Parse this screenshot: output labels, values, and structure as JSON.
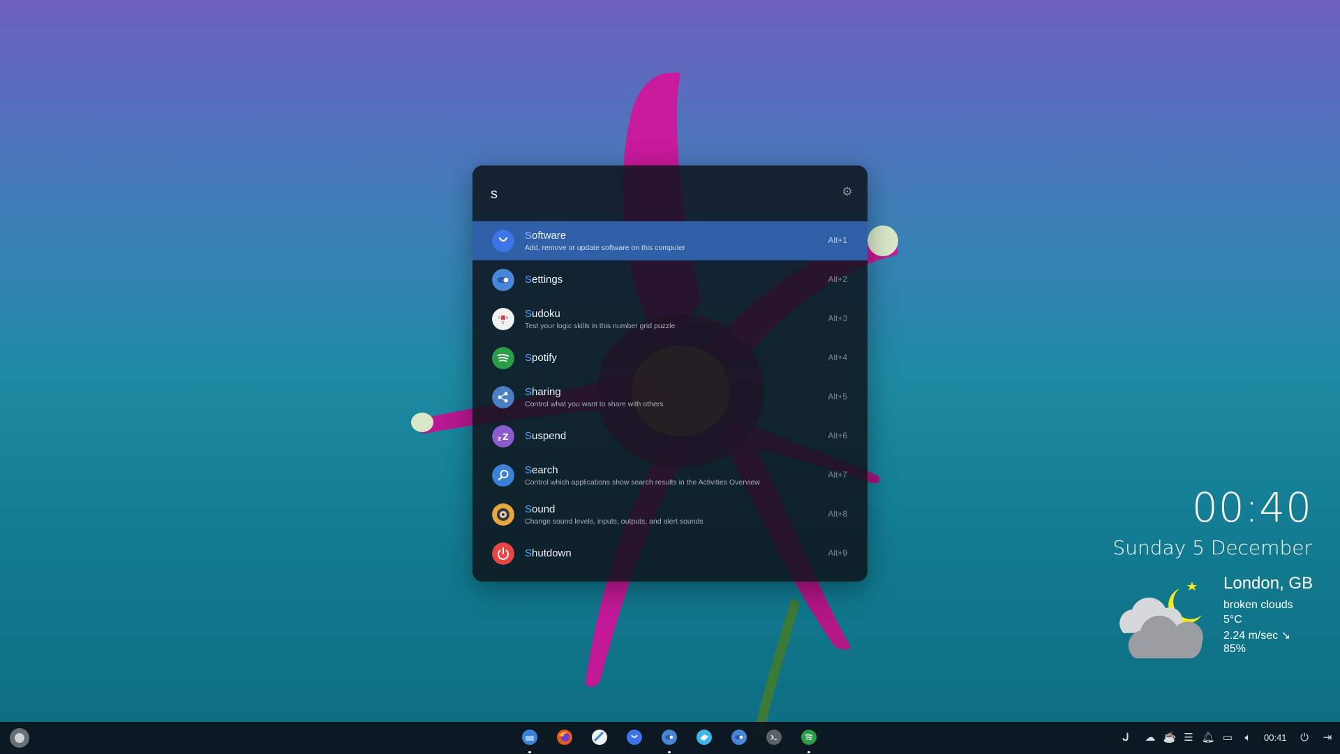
{
  "launcher": {
    "query": "s",
    "results": [
      {
        "hl": "S",
        "rest": "oftware",
        "desc": "Add, remove or update software on this computer",
        "shortcut": "Alt+1",
        "icon": "software-bag-icon"
      },
      {
        "hl": "S",
        "rest": "ettings",
        "desc": "",
        "shortcut": "Alt+2",
        "icon": "settings-toggle-icon"
      },
      {
        "hl": "S",
        "rest": "udoku",
        "desc": "Test your logic skills in this number grid puzzle",
        "shortcut": "Alt+3",
        "icon": "sudoku-icon"
      },
      {
        "hl": "S",
        "rest": "potify",
        "desc": "",
        "shortcut": "Alt+4",
        "icon": "spotify-icon"
      },
      {
        "hl": "S",
        "rest": "haring",
        "desc": "Control what you want to share with others",
        "shortcut": "Alt+5",
        "icon": "sharing-icon"
      },
      {
        "hl": "S",
        "rest": "uspend",
        "desc": "",
        "shortcut": "Alt+6",
        "icon": "suspend-icon"
      },
      {
        "hl": "S",
        "rest": "earch",
        "desc": "Control which applications show search results in the Activities Overview",
        "shortcut": "Alt+7",
        "icon": "search-icon"
      },
      {
        "hl": "S",
        "rest": "ound",
        "desc": "Change sound levels, inputs, outputs, and alert sounds",
        "shortcut": "Alt+8",
        "icon": "sound-icon"
      },
      {
        "hl": "S",
        "rest": "hutdown",
        "desc": "",
        "shortcut": "Alt+9",
        "icon": "shutdown-icon"
      }
    ]
  },
  "clock": {
    "time": "00:40",
    "date": "Sunday  5 December"
  },
  "weather": {
    "city": "London, GB",
    "condition": "broken clouds",
    "temperature": "5°C",
    "wind": "2.24 m/sec ↘",
    "humidity": "85%",
    "icon": "cloud-moon-icon"
  },
  "taskbar": {
    "dock": [
      "files-icon",
      "firefox-icon",
      "disk-icon",
      "software-icon",
      "settings-icon",
      "store-icon",
      "toggle-icon",
      "terminal-icon",
      "spotify-icon"
    ],
    "tray_time": "00:41"
  },
  "colors": {
    "accent": "#2f5fa6",
    "highlight": "#5aa2ff",
    "panel": "#0e141c"
  }
}
